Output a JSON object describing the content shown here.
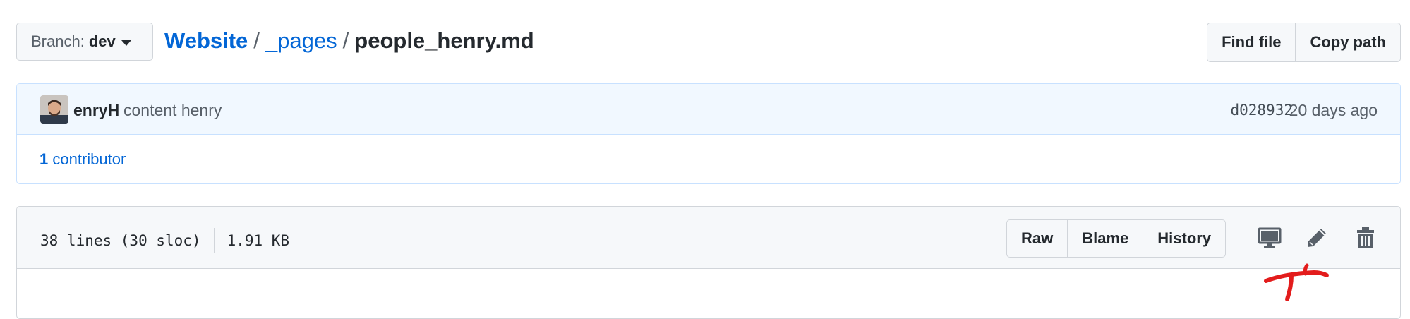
{
  "header": {
    "branch_label": "Branch:",
    "branch_value": "dev",
    "breadcrumb": {
      "repo": "Website",
      "sep1": "/",
      "dir": "_pages",
      "sep2": "/",
      "file": "people_henry.md"
    },
    "find_file": "Find file",
    "copy_path": "Copy path"
  },
  "commit": {
    "author": "enryH",
    "message": "content henry",
    "sha": "d028932",
    "age": "20 days ago",
    "contributors_count": "1",
    "contributors_label": "contributor"
  },
  "file": {
    "lines_info": "38 lines (30 sloc)",
    "size": "1.91 KB",
    "raw": "Raw",
    "blame": "Blame",
    "history": "History"
  },
  "icons": {
    "caret": "chevron-down-icon",
    "desktop": "desktop-icon",
    "edit": "pencil-icon",
    "delete": "trash-icon",
    "annotation": "red-arrow-annotation"
  },
  "colors": {
    "link": "#0366d6",
    "commit_bg": "#f1f8ff",
    "annotation": "#e31c1c"
  }
}
